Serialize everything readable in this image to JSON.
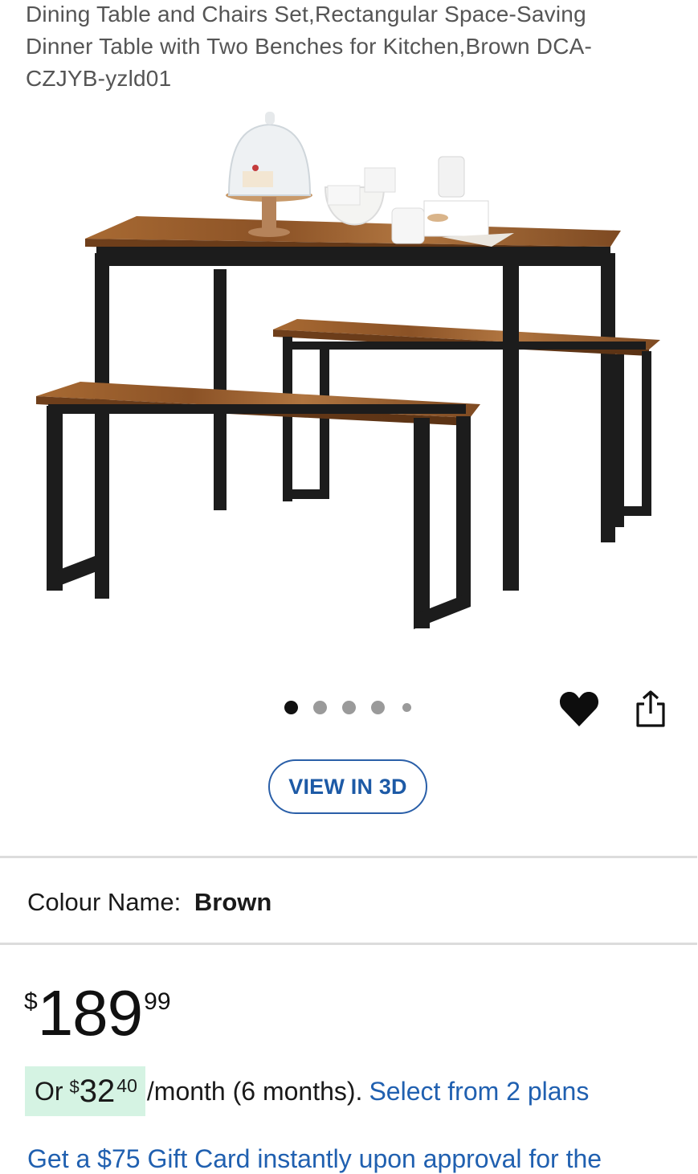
{
  "product": {
    "title_lines": [
      "Dining Table and Chairs Set,Rectangular Space-Saving",
      "Dinner Table with Two Benches for Kitchen,Brown DCA-",
      "CZJYB-yzld01"
    ],
    "image_alt": "Dining table with two benches",
    "gallery": {
      "total_images": 5,
      "active_index": 1
    },
    "view_3d_label": "VIEW IN 3D",
    "colour": {
      "label": "Colour Name:",
      "value": "Brown"
    },
    "price": {
      "currency": "$",
      "dollars": "189",
      "cents": "99"
    },
    "financing": {
      "prefix": "Or",
      "currency": "$",
      "dollars": "32",
      "cents": "40",
      "suffix": "/month (6 months).",
      "link": "Select from 2 plans"
    },
    "cut_off_link": "Get a $75 Gift Card instantly upon approval for the"
  },
  "icons": {
    "favorite": "heart-icon",
    "share": "share-icon"
  },
  "colors": {
    "link": "#2060b0",
    "badge_bg": "#d5f3e3",
    "wood": "#9a5f2c",
    "metal": "#1c1c1c"
  }
}
